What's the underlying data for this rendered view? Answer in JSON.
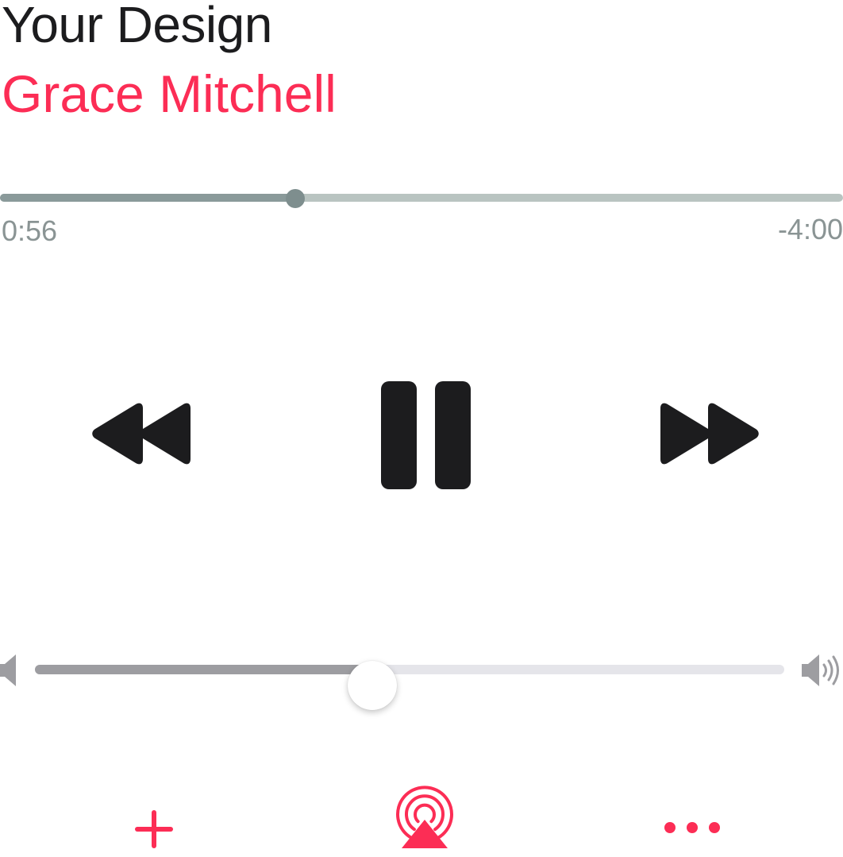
{
  "now_playing": {
    "title": "Your Design",
    "artist": "Grace Mitchell"
  },
  "playback": {
    "elapsed": "0:56",
    "remaining": "-4:00",
    "progress_fraction": 0.35
  },
  "controls": {
    "rewind_icon": "rewind-icon",
    "pause_icon": "pause-icon",
    "fast_forward_icon": "fast-forward-icon"
  },
  "volume": {
    "level_fraction": 0.45,
    "low_icon": "speaker-low-icon",
    "high_icon": "speaker-high-icon"
  },
  "actions": {
    "add_icon": "plus-icon",
    "airplay_icon": "airplay-icon",
    "more_icon": "ellipsis-icon"
  },
  "colors": {
    "accent": "#fc2d55",
    "title": "#1c1c1e",
    "scrubber_fill": "#8a9a9a",
    "scrubber_track": "#b9c4c1",
    "volume_fill": "#9d9da1",
    "volume_track": "#e5e5ea"
  }
}
